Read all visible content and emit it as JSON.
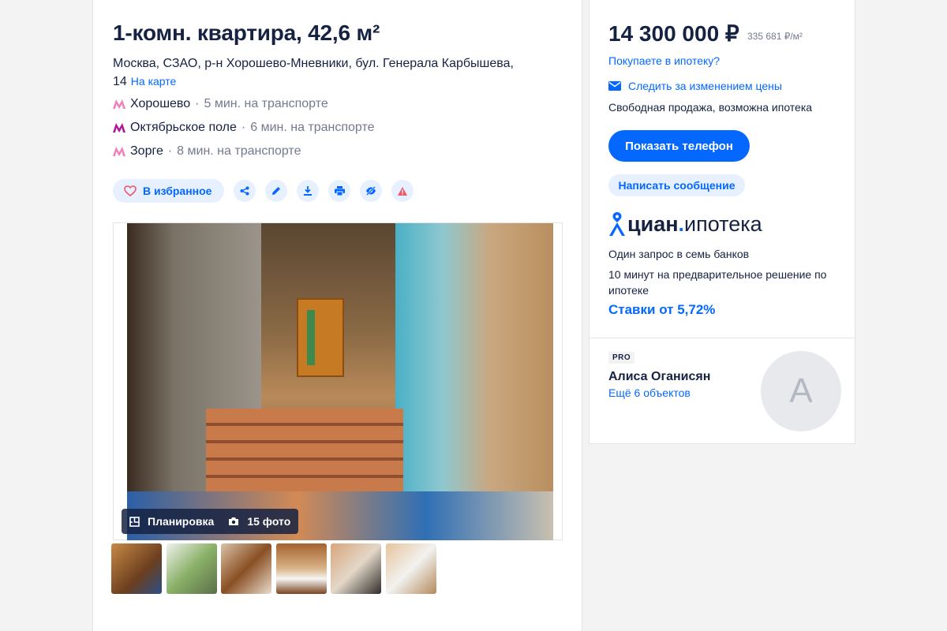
{
  "listing": {
    "title": "1-комн. квартира, 42,6 м²",
    "address": "Москва, СЗАО, р-н Хорошево-Мневники, бул. Генерала Карбышева, 14",
    "map_link": "На карте",
    "metro": [
      {
        "name": "Хорошево",
        "time": "5 мин. на транспорте",
        "color": "#f182bc"
      },
      {
        "name": "Октябрьское поле",
        "time": "6 мин. на транспорте",
        "color": "#b1179a"
      },
      {
        "name": "Зорге",
        "time": "8 мин. на транспорте",
        "color": "#f182bc"
      }
    ],
    "favorite_label": "В избранное",
    "action_icons": [
      "share-icon",
      "edit-icon",
      "download-icon",
      "print-icon",
      "hide-icon",
      "report-icon"
    ],
    "gallery": {
      "layout_label": "Планировка",
      "photos_label": "15 фото"
    }
  },
  "sidebar": {
    "price": "14 300 000 ₽",
    "price_per_m2": "335 681 ₽/м²",
    "mortgage_question": "Покупаете в ипотеку?",
    "track_price": "Следить за изменением цены",
    "sale_type": "Свободная продажа, возможна ипотека",
    "phone_button": "Показать телефон",
    "message_button": "Написать сообщение",
    "mortgage": {
      "brand": "циан",
      "product": "ипотека",
      "line1": "Один запрос в семь банков",
      "line2": "10 минут на предварительное решение по ипотеке",
      "rates": "Ставки от 5,72%"
    },
    "agent": {
      "badge": "PRO",
      "name": "Алиса Оганисян",
      "more": "Ещё 6 объектов",
      "initial": "А"
    }
  },
  "colors": {
    "accent": "#0468ff",
    "accent_light": "#e6f0ff",
    "text": "#152242",
    "muted": "#737a8e"
  }
}
